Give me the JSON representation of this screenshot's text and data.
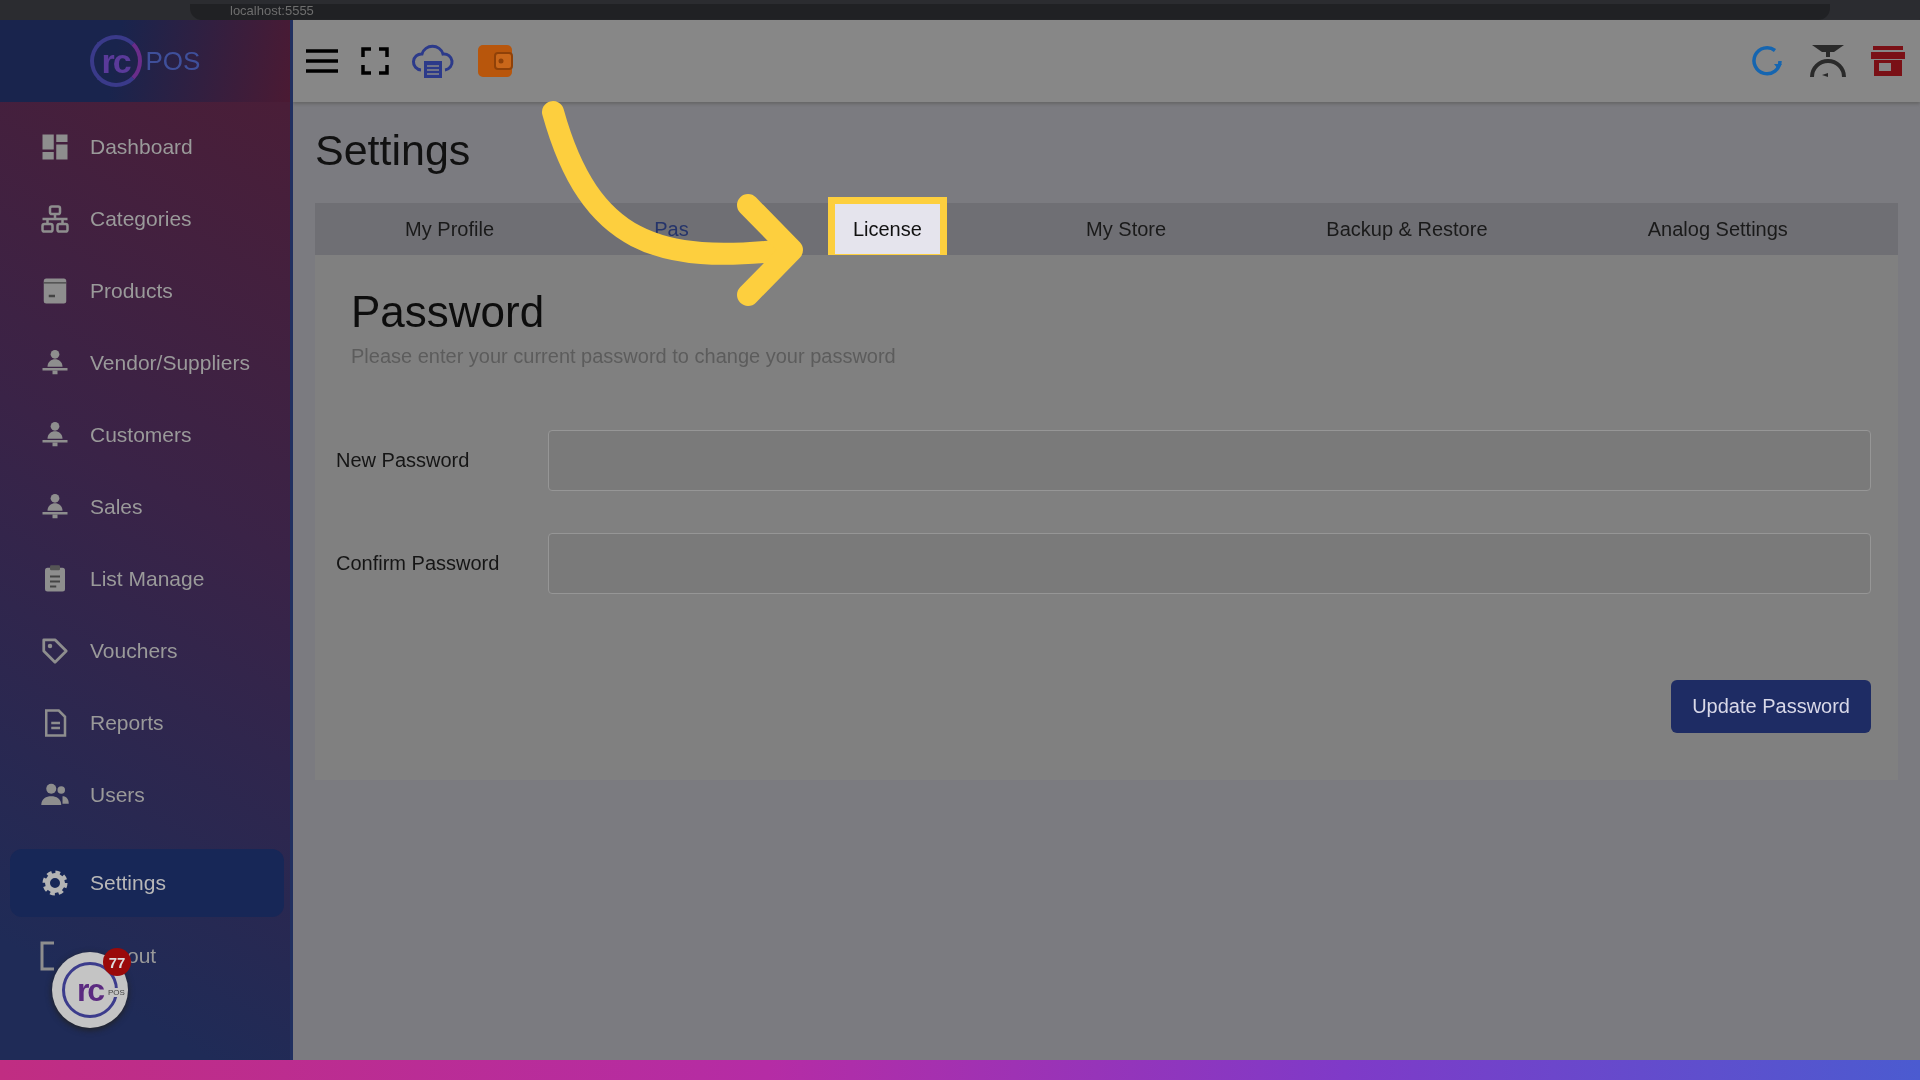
{
  "browser": {
    "url": "localhost:5555"
  },
  "logo": {
    "mark": "rc",
    "text": "POS"
  },
  "sidebar": {
    "items": [
      {
        "label": "Dashboard",
        "selected": false
      },
      {
        "label": "Categories",
        "selected": false
      },
      {
        "label": "Products",
        "selected": false
      },
      {
        "label": "Vendor/Suppliers",
        "selected": false
      },
      {
        "label": "Customers",
        "selected": false
      },
      {
        "label": "Sales",
        "selected": false
      },
      {
        "label": "List Manage",
        "selected": false
      },
      {
        "label": "Vouchers",
        "selected": false
      },
      {
        "label": "Reports",
        "selected": false
      },
      {
        "label": "Users",
        "selected": false
      }
    ],
    "footer_items": [
      {
        "label": "Settings",
        "selected": true
      },
      {
        "label": "out",
        "selected": false
      }
    ]
  },
  "page": {
    "title": "Settings"
  },
  "tabs": [
    {
      "label": "My Profile",
      "selected": false,
      "highlighted": false
    },
    {
      "label": "Pas",
      "selected": true,
      "highlighted": false
    },
    {
      "label": "License",
      "selected": false,
      "highlighted": true
    },
    {
      "label": "My Store",
      "selected": false,
      "highlighted": false
    },
    {
      "label": "Backup & Restore",
      "selected": false,
      "highlighted": false
    },
    {
      "label": "Analog Settings",
      "selected": false,
      "highlighted": false
    }
  ],
  "panel": {
    "title": "Password",
    "subtitle": "Please enter your current password to change your password",
    "fields": [
      {
        "label": "New Password"
      },
      {
        "label": "Confirm Password"
      }
    ],
    "button": "Update Password"
  },
  "help_badge": {
    "mark": "rc",
    "sub": "POS",
    "count": "77"
  }
}
